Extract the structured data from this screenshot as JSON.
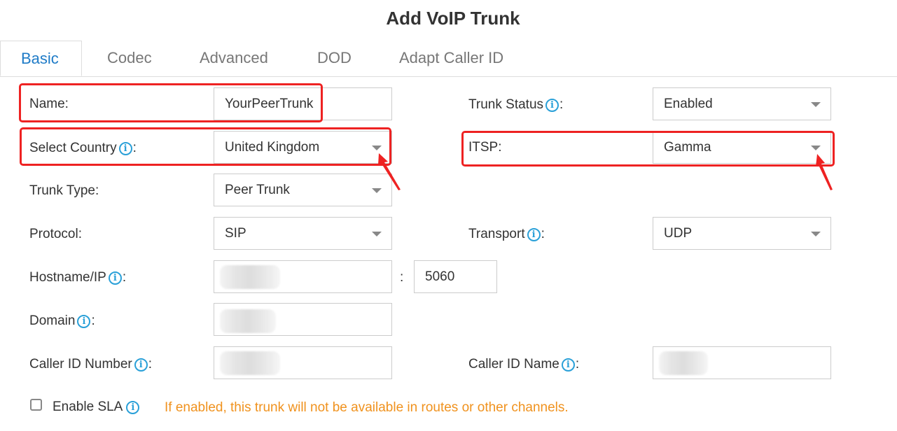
{
  "dialog": {
    "title": "Add VoIP Trunk"
  },
  "tabs": [
    {
      "label": "Basic",
      "active": true
    },
    {
      "label": "Codec",
      "active": false
    },
    {
      "label": "Advanced",
      "active": false
    },
    {
      "label": "DOD",
      "active": false
    },
    {
      "label": "Adapt Caller ID",
      "active": false
    }
  ],
  "form": {
    "name": {
      "label": "Name:",
      "value": "YourPeerTrunk"
    },
    "trunk_status": {
      "label": "Trunk Status",
      "suffix": ":",
      "value": "Enabled"
    },
    "select_country": {
      "label": "Select Country",
      "suffix": ":",
      "value": "United Kingdom"
    },
    "itsp": {
      "label": "ITSP:",
      "value": "Gamma"
    },
    "trunk_type": {
      "label": "Trunk Type:",
      "value": "Peer Trunk"
    },
    "protocol": {
      "label": "Protocol:",
      "value": "SIP"
    },
    "transport": {
      "label": "Transport",
      "suffix": ":",
      "value": "UDP"
    },
    "hostname": {
      "label": "Hostname/IP",
      "suffix": ":",
      "value": "",
      "port_separator": ":",
      "port": "5060"
    },
    "domain": {
      "label": "Domain",
      "suffix": ":",
      "value": ""
    },
    "caller_id_number": {
      "label": "Caller ID Number",
      "suffix": ":",
      "value": ""
    },
    "caller_id_name": {
      "label": "Caller ID Name",
      "suffix": ":",
      "value": ""
    },
    "enable_sla": {
      "label": "Enable SLA",
      "checked": false,
      "hint": "If enabled, this trunk will not be available in routes or other channels."
    }
  },
  "icons": {
    "info": "i"
  },
  "annotation_color": "#ee2222"
}
